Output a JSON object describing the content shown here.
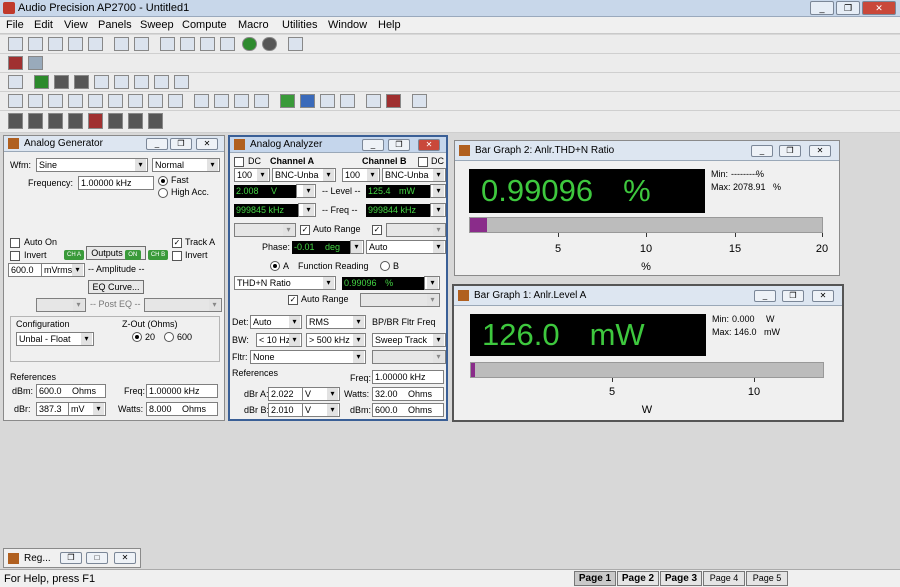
{
  "app": {
    "title": "Audio Precision AP2700 - Untitled1"
  },
  "menu": [
    "File",
    "Edit",
    "View",
    "Panels",
    "Sweep",
    "Compute",
    "Macro",
    "Utilities",
    "Window",
    "Help"
  ],
  "generator": {
    "title": "Analog Generator",
    "wfm_label": "Wfm:",
    "wfm_value": "Sine",
    "wfm_mode": "Normal",
    "freq_label": "Frequency:",
    "freq_value": "1.00000 kHz",
    "fast": "Fast",
    "high_acc": "High Acc.",
    "auto_on": "Auto On",
    "invert": "Invert",
    "outputs": "Outputs",
    "track_a": "Track A",
    "invert_b": "Invert",
    "ch_a": "CH A",
    "ch_b": "CH B",
    "ch_tag": "ON",
    "amplitude_value": "600.0",
    "amplitude_unit": "mVrms",
    "amplitude_label": "-- Amplitude --",
    "eq_curve": "EQ Curve...",
    "post_eq": "-- Post EQ --",
    "config_label": "Configuration",
    "config_value": "Unbal - Float",
    "zout_label": "Z-Out (Ohms)",
    "zout_20": "20",
    "zout_600": "600",
    "references": "References",
    "dbm_label": "dBm:",
    "dbm_value": "600.0",
    "dbm_unit": "Ohms",
    "dbr_label": "dBr:",
    "dbr_value": "387.3",
    "dbr_unit": "mV",
    "freq_ref_label": "Freq:",
    "freq_ref_value": "1.00000 kHz",
    "watts_label": "Watts:",
    "watts_value": "8.000",
    "watts_unit": "Ohms"
  },
  "analyzer": {
    "title": "Analog Analyzer",
    "dc": "DC",
    "channel_a": "Channel A",
    "channel_b": "Channel B",
    "dc_b": "DC",
    "range_a": "100",
    "input_a": "BNC-Unba",
    "range_b": "100",
    "input_b": "BNC-Unba",
    "level_a": "2.008",
    "level_a_unit": "V",
    "level_label": "-- Level --",
    "level_b": "125.4",
    "level_b_unit": "mW",
    "freq_a": "999845 kHz",
    "freq_label": "-- Freq --",
    "freq_b": "999844 kHz",
    "auto_range": "Auto Range",
    "phase_label": "Phase:",
    "phase_value": "-0.01",
    "phase_unit": "deg",
    "phase_mode": "Auto",
    "fn_a": "A",
    "function_reading": "Function Reading",
    "fn_b": "B",
    "fn_type": "THD+N Ratio",
    "fn_value": "0.99096",
    "fn_unit": "%",
    "auto_range2": "Auto Range",
    "det_label": "Det:",
    "det_value": "Auto",
    "rms": "RMS",
    "bpbr_label": "BP/BR Fltr Freq",
    "bw_label": "BW:",
    "bw_lo": "< 10 Hz",
    "bw_hi": "> 500 kHz",
    "sweep_track": "Sweep Track",
    "fltr_label": "Fltr:",
    "fltr_value": "None",
    "references": "References",
    "freq_ref_label": "Freq:",
    "freq_ref_value": "1.00000 kHz",
    "dbra_label": "dBr A:",
    "dbra_value": "2.022",
    "dbra_unit": "V",
    "watts_label": "Watts:",
    "watts_value": "32.00",
    "watts_unit": "Ohms",
    "dbrb_label": "dBr B:",
    "dbrb_value": "2.010",
    "dbrb_unit": "V",
    "dbm_label": "dBm:",
    "dbm_value": "600.0",
    "dbm_unit": "Ohms"
  },
  "bargraph2": {
    "title": "Bar Graph 2: Anlr.THD+N Ratio",
    "value": "0.99096",
    "unit": "%",
    "min_label": "Min:",
    "min_value": "---------",
    "min_unit": "%",
    "max_label": "Max:",
    "max_value": "2078.91",
    "max_unit": "%",
    "fill_fraction": 0.0495,
    "ticks": [
      "5",
      "10",
      "15",
      "20"
    ],
    "axis_unit": "%"
  },
  "bargraph1": {
    "title": "Bar Graph 1: Anlr.Level A",
    "value": "126.0",
    "unit": "mW",
    "min_label": "Min:",
    "min_value": "0.000",
    "min_unit": "W",
    "max_label": "Max:",
    "max_value": "146.0",
    "max_unit": "mW",
    "fill_fraction": 0.0126,
    "ticks": [
      "5",
      "10"
    ],
    "axis_unit": "W"
  },
  "minimized": {
    "title": "Reg..."
  },
  "status": {
    "help": "For Help, press F1"
  },
  "pages": [
    "Page 1",
    "Page 2",
    "Page 3",
    "Page 4",
    "Page 5"
  ]
}
